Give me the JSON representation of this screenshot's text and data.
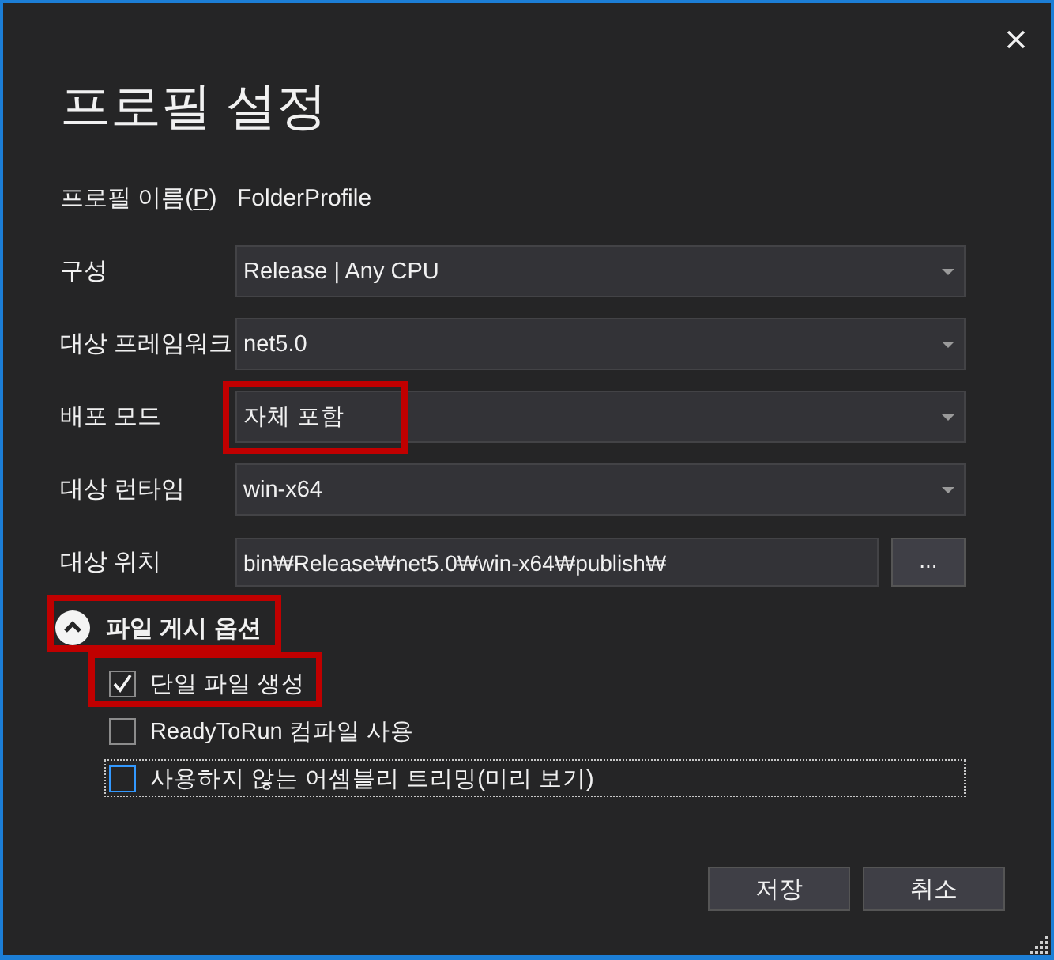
{
  "window": {
    "title": "프로필 설정"
  },
  "profile_name": {
    "label": "프로필 이름(",
    "mnemonic": "P",
    "label_end": ")",
    "value": "FolderProfile"
  },
  "fields": [
    {
      "kind": "dropdown",
      "label": "구성",
      "value": "Release | Any CPU",
      "highlighted": false
    },
    {
      "kind": "dropdown",
      "label": "대상 프레임워크",
      "value": "net5.0",
      "highlighted": false
    },
    {
      "kind": "dropdown",
      "label": "배포 모드",
      "value": "자체 포함",
      "highlighted": true
    },
    {
      "kind": "dropdown",
      "label": "대상 런타임",
      "value": "win-x64",
      "highlighted": false
    },
    {
      "kind": "path",
      "label": "대상 위치",
      "value": "bin₩Release₩net5.0₩win-x64₩publish₩",
      "button": "...",
      "highlighted": false
    }
  ],
  "publish_options": {
    "title": "파일 게시 옵션",
    "expanded": true,
    "highlighted": true,
    "options": [
      {
        "label": "단일 파일 생성",
        "checked": true,
        "focused": false,
        "highlighted": true
      },
      {
        "label": "ReadyToRun 컴파일 사용",
        "checked": false,
        "focused": false,
        "highlighted": false
      },
      {
        "label": "사용하지 않는 어셈블리 트리밍(미리 보기)",
        "checked": false,
        "focused": true,
        "highlighted": false
      }
    ]
  },
  "buttons": [
    {
      "label": "저장"
    },
    {
      "label": "취소"
    }
  ]
}
